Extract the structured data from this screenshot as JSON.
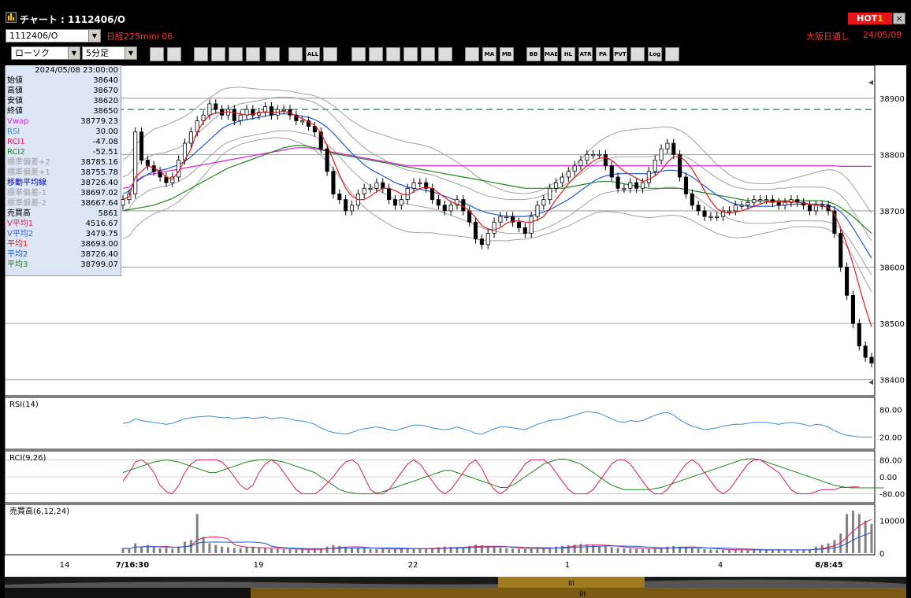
{
  "window": {
    "title": "チャート : 1112406/O",
    "hot_label": "HOT",
    "hot_num": "1",
    "close": "×"
  },
  "row1": {
    "code": "1112406/O",
    "name": "日経225mini 06",
    "session": "大阪日通し",
    "date": "24/05/09"
  },
  "controls": {
    "chart_type": "ローソク",
    "interval": "5分足"
  },
  "toolbar_icons": [
    "zoom-icon",
    "crosshair-icon",
    "download-icon",
    "magnify-icon",
    "swap-icon",
    "blank-icon",
    "candle-icon",
    "candle-icon-2",
    "all-icon",
    "pen-icon",
    "line-icon",
    "arrow-icon",
    "note-icon",
    "trash-icon",
    "settings-icon",
    "wrench-icon",
    "palette-icon",
    "ma-icon",
    "mb-icon",
    "bb-icon",
    "mae-icon",
    "hl-icon",
    "atr-icon",
    "para-icon",
    "pvt-icon",
    "box-icon",
    "log-icon",
    "exit-icon"
  ],
  "toolbar_labels": [
    "",
    "",
    "",
    "",
    "",
    "",
    "",
    "",
    "ALL",
    "",
    "",
    "",
    "",
    "",
    "",
    "",
    "",
    "MA",
    "MB",
    "BB",
    "MAE",
    "HL",
    "ATR",
    "PA RA",
    "PVT",
    "",
    "Log",
    ""
  ],
  "panel": {
    "datetime": "2024/05/08  23:00:00",
    "rows": [
      {
        "label": "始値",
        "value": "38640",
        "color": "#000000"
      },
      {
        "label": "高値",
        "value": "38670",
        "color": "#000000"
      },
      {
        "label": "安値",
        "value": "38620",
        "color": "#000000"
      },
      {
        "label": "終値",
        "value": "38650",
        "color": "#000000"
      },
      {
        "label": "Vwap",
        "value": "38779.23",
        "color": "#e01ae0"
      },
      {
        "label": "RSI",
        "value": "30.00",
        "color": "#3a8bd8"
      },
      {
        "label": "RCI1",
        "value": "-47.08",
        "color": "#e01a60"
      },
      {
        "label": "RCI2",
        "value": "-52.51",
        "color": "#1a8a1a"
      },
      {
        "label": "標準偏差+2",
        "value": "38785.16",
        "color": "#a0a0a0"
      },
      {
        "label": "標準偏差+1",
        "value": "38755.78",
        "color": "#a0a0a0"
      },
      {
        "label": "移動平均線",
        "value": "38726.40",
        "color": "#0000c0"
      },
      {
        "label": "標準偏差-1",
        "value": "38697.02",
        "color": "#a0a0a0"
      },
      {
        "label": "標準偏差-2",
        "value": "38667.64",
        "color": "#a0a0a0"
      },
      {
        "label": "売買高",
        "value": "5861",
        "color": "#000000"
      },
      {
        "label": "V平均1",
        "value": "4516.67",
        "color": "#e01a60"
      },
      {
        "label": "V平均2",
        "value": "3479.75",
        "color": "#3a5ad8"
      },
      {
        "label": "平均1",
        "value": "38693.00",
        "color": "#e01a1a"
      },
      {
        "label": "平均2",
        "value": "38726.40",
        "color": "#1a5ad8"
      },
      {
        "label": "平均3",
        "value": "38799.07",
        "color": "#1a8a1a"
      }
    ]
  },
  "colors": {
    "up": "#ffffff",
    "down": "#000000",
    "sma1": "#e01a1a",
    "sma2": "#1a5ad8",
    "sma3": "#1a8a1a",
    "vwap": "#e01ae0",
    "bb": "#a0a0a0",
    "rsi": "#3a8bd8",
    "rci1": "#e01a60",
    "rci2": "#1a8a1a",
    "vol": "#808080",
    "dashed": "#1a7a7a"
  },
  "chart_data": [
    {
      "type": "candlestick",
      "title": "",
      "y_ticks": [
        "38900",
        "38800",
        "38700",
        "38600",
        "38500",
        "38400"
      ],
      "ylim": [
        38380,
        38950
      ],
      "x_ticks": [
        "14",
        "7/16:30",
        "19",
        "22",
        "1",
        "4",
        "8/8:45"
      ],
      "dashed_level": 38880,
      "closes": [
        38720,
        38730,
        38840,
        38790,
        38780,
        38770,
        38760,
        38750,
        38760,
        38790,
        38820,
        38840,
        38860,
        38870,
        38890,
        38880,
        38870,
        38880,
        38860,
        38870,
        38880,
        38870,
        38875,
        38885,
        38870,
        38880,
        38880,
        38870,
        38860,
        38860,
        38850,
        38840,
        38810,
        38770,
        38730,
        38720,
        38700,
        38710,
        38730,
        38740,
        38740,
        38750,
        38740,
        38720,
        38710,
        38720,
        38740,
        38750,
        38750,
        38740,
        38720,
        38710,
        38700,
        38710,
        38720,
        38700,
        38680,
        38650,
        38640,
        38660,
        38680,
        38690,
        38690,
        38680,
        38670,
        38660,
        38690,
        38710,
        38720,
        38740,
        38750,
        38760,
        38770,
        38780,
        38790,
        38800,
        38800,
        38800,
        38780,
        38760,
        38740,
        38740,
        38750,
        38740,
        38750,
        38770,
        38790,
        38810,
        38820,
        38800,
        38760,
        38730,
        38710,
        38700,
        38690,
        38690,
        38690,
        38700,
        38700,
        38710,
        38710,
        38715,
        38720,
        38720,
        38720,
        38715,
        38710,
        38715,
        38720,
        38715,
        38710,
        38700,
        38710,
        38710,
        38700,
        38660,
        38600,
        38550,
        38500,
        38460,
        38440,
        38430
      ],
      "sma1": [
        38720,
        38725,
        38760,
        38770,
        38780,
        38776,
        38770,
        38760,
        38756,
        38770,
        38790,
        38810,
        38840,
        38858,
        38870,
        38874,
        38874,
        38876,
        38874,
        38872,
        38870,
        38872,
        38874,
        38876,
        38874,
        38875,
        38877,
        38874,
        38868,
        38864,
        38858,
        38852,
        38838,
        38816,
        38790,
        38764,
        38740,
        38726,
        38720,
        38720,
        38726,
        38734,
        38740,
        38740,
        38736,
        38730,
        38728,
        38734,
        38740,
        38742,
        38740,
        38732,
        38724,
        38716,
        38712,
        38708,
        38700,
        38688,
        38674,
        38668,
        38666,
        38670,
        38678,
        38682,
        38682,
        38680,
        38680,
        38684,
        38690,
        38704,
        38720,
        38734,
        38748,
        38760,
        38770,
        38780,
        38788,
        38794,
        38794,
        38790,
        38780,
        38770,
        38764,
        38758,
        38752,
        38756,
        38762,
        38772,
        38786,
        38796,
        38796,
        38788,
        38774,
        38756,
        38736,
        38718,
        38704,
        38698,
        38696,
        38698,
        38700,
        38704,
        38708,
        38712,
        38716,
        38716,
        38716,
        38716,
        38716,
        38715,
        38714,
        38712,
        38710,
        38709,
        38706,
        38694,
        38670,
        38640,
        38606,
        38566,
        38528,
        38494
      ],
      "sma2": [
        38730,
        38735,
        38750,
        38758,
        38765,
        38770,
        38772,
        38774,
        38778,
        38782,
        38788,
        38796,
        38806,
        38816,
        38826,
        38836,
        38846,
        38852,
        38856,
        38860,
        38862,
        38864,
        38866,
        38868,
        38870,
        38872,
        38872,
        38872,
        38870,
        38868,
        38866,
        38862,
        38856,
        38848,
        38838,
        38826,
        38814,
        38802,
        38792,
        38782,
        38774,
        38768,
        38762,
        38756,
        38750,
        38746,
        38742,
        38740,
        38738,
        38736,
        38734,
        38730,
        38726,
        38722,
        38718,
        38714,
        38710,
        38704,
        38700,
        38696,
        38694,
        38692,
        38690,
        38690,
        38690,
        38690,
        38692,
        38694,
        38698,
        38702,
        38708,
        38714,
        38720,
        38728,
        38736,
        38744,
        38752,
        38758,
        38762,
        38764,
        38766,
        38766,
        38766,
        38766,
        38766,
        38766,
        38768,
        38770,
        38772,
        38772,
        38770,
        38766,
        38760,
        38752,
        38744,
        38736,
        38728,
        38722,
        38716,
        38712,
        38710,
        38708,
        38708,
        38708,
        38708,
        38708,
        38710,
        38710,
        38712,
        38712,
        38712,
        38712,
        38712,
        38712,
        38710,
        38706,
        38698,
        38686,
        38670,
        38652,
        38634,
        38616
      ],
      "sma3": [
        38700,
        38702,
        38704,
        38706,
        38708,
        38710,
        38714,
        38718,
        38722,
        38728,
        38734,
        38740,
        38746,
        38752,
        38758,
        38764,
        38770,
        38776,
        38780,
        38784,
        38788,
        38792,
        38796,
        38800,
        38804,
        38808,
        38812,
        38814,
        38816,
        38816,
        38814,
        38812,
        38810,
        38806,
        38802,
        38800,
        38798,
        38796,
        38794,
        38792,
        38790,
        38788,
        38786,
        38784,
        38782,
        38780,
        38778,
        38776,
        38774,
        38772,
        38770,
        38768,
        38766,
        38764,
        38762,
        38760,
        38758,
        38756,
        38754,
        38752,
        38750,
        38748,
        38746,
        38744,
        38742,
        38740,
        38740,
        38740,
        38740,
        38740,
        38740,
        38740,
        38742,
        38744,
        38746,
        38748,
        38750,
        38752,
        38752,
        38752,
        38750,
        38748,
        38746,
        38744,
        38742,
        38740,
        38740,
        38740,
        38740,
        38740,
        38740,
        38738,
        38736,
        38734,
        38732,
        38730,
        38728,
        38726,
        38724,
        38722,
        38720,
        38718,
        38718,
        38718,
        38718,
        38718,
        38718,
        38718,
        38718,
        38718,
        38718,
        38718,
        38718,
        38718,
        38716,
        38712,
        38706,
        38698,
        38690,
        38680,
        38670,
        38660
      ],
      "vwap": [
        38740,
        38742,
        38752,
        38760,
        38764,
        38766,
        38768,
        38770,
        38772,
        38774,
        38776,
        38778,
        38780,
        38782,
        38784,
        38786,
        38788,
        38790,
        38792,
        38794,
        38796,
        38798,
        38800,
        38802,
        38804,
        38806,
        38808,
        38810,
        38812,
        38812,
        38812,
        38810,
        38808,
        38806,
        38804,
        38802,
        38800,
        38798,
        38796,
        38794,
        38792,
        38790,
        38788,
        38786,
        38784,
        38782,
        38780,
        38780,
        38780,
        38780,
        38780,
        38780,
        38780,
        38780,
        38780,
        38780,
        38780,
        38780,
        38780,
        38780,
        38780,
        38780,
        38780,
        38780,
        38780,
        38780,
        38780,
        38780,
        38780,
        38780,
        38780,
        38780,
        38780,
        38780,
        38780,
        38780,
        38780,
        38780,
        38780,
        38780,
        38780,
        38780,
        38780,
        38780,
        38780,
        38780,
        38780,
        38780,
        38780,
        38780,
        38780,
        38780,
        38780,
        38780,
        38780,
        38780,
        38780,
        38780,
        38780,
        38780,
        38780,
        38780,
        38780,
        38780,
        38780,
        38780,
        38780,
        38780,
        38780,
        38780,
        38780,
        38780,
        38780,
        38780,
        38780,
        38780,
        38779,
        38779,
        38779,
        38779,
        38779,
        38779
      ],
      "rsi": [
        50,
        52,
        60,
        56,
        54,
        52,
        50,
        48,
        50,
        55,
        60,
        62,
        64,
        65,
        66,
        64,
        62,
        63,
        60,
        62,
        63,
        61,
        62,
        64,
        60,
        62,
        62,
        60,
        56,
        55,
        52,
        48,
        40,
        34,
        30,
        28,
        26,
        30,
        35,
        38,
        40,
        42,
        40,
        36,
        34,
        38,
        42,
        46,
        46,
        44,
        40,
        38,
        36,
        38,
        42,
        38,
        34,
        28,
        26,
        32,
        38,
        42,
        42,
        40,
        38,
        36,
        42,
        48,
        52,
        56,
        58,
        60,
        64,
        68,
        72,
        76,
        74,
        72,
        66,
        60,
        54,
        52,
        56,
        54,
        56,
        62,
        68,
        72,
        74,
        68,
        58,
        50,
        44,
        40,
        36,
        38,
        40,
        44,
        46,
        48,
        48,
        50,
        52,
        52,
        52,
        50,
        48,
        50,
        52,
        50,
        48,
        44,
        48,
        46,
        42,
        34,
        28,
        24,
        22,
        20,
        20,
        20
      ],
      "rci1": [
        -20,
        20,
        70,
        80,
        60,
        20,
        -40,
        -70,
        -80,
        -40,
        20,
        60,
        80,
        80,
        80,
        80,
        70,
        40,
        0,
        -40,
        -60,
        -40,
        20,
        60,
        80,
        60,
        20,
        -20,
        -60,
        -80,
        -80,
        -80,
        -60,
        -30,
        0,
        40,
        70,
        80,
        60,
        0,
        -60,
        -80,
        -80,
        -60,
        -20,
        20,
        60,
        80,
        60,
        20,
        -20,
        -60,
        -80,
        -60,
        -20,
        20,
        60,
        80,
        40,
        -20,
        -60,
        -80,
        -60,
        -20,
        20,
        60,
        80,
        80,
        80,
        60,
        20,
        -20,
        -60,
        -80,
        -80,
        -80,
        -60,
        -20,
        20,
        60,
        80,
        80,
        60,
        20,
        -20,
        -60,
        -80,
        -80,
        -60,
        -20,
        20,
        60,
        80,
        60,
        20,
        -20,
        -60,
        -80,
        -60,
        -20,
        20,
        60,
        80,
        80,
        60,
        40,
        20,
        -20,
        -60,
        -80,
        -80,
        -80,
        -70,
        -60,
        -60,
        -60,
        -50,
        -50,
        -47,
        -47
      ],
      "rci2": [
        20,
        30,
        40,
        50,
        60,
        70,
        75,
        80,
        75,
        70,
        60,
        50,
        40,
        30,
        20,
        20,
        30,
        40,
        50,
        60,
        70,
        75,
        80,
        80,
        80,
        75,
        70,
        60,
        50,
        40,
        30,
        20,
        0,
        -20,
        -40,
        -60,
        -70,
        -75,
        -80,
        -80,
        -80,
        -75,
        -70,
        -60,
        -50,
        -40,
        -30,
        -20,
        -10,
        0,
        10,
        20,
        30,
        30,
        20,
        10,
        0,
        -10,
        -20,
        -30,
        -40,
        -50,
        -50,
        -40,
        -20,
        0,
        20,
        40,
        60,
        70,
        80,
        85,
        80,
        70,
        60,
        40,
        20,
        0,
        -20,
        -40,
        -50,
        -60,
        -60,
        -60,
        -60,
        -60,
        -55,
        -50,
        -40,
        -30,
        -20,
        -10,
        0,
        10,
        20,
        30,
        40,
        50,
        60,
        70,
        80,
        85,
        85,
        80,
        70,
        60,
        50,
        40,
        30,
        20,
        10,
        0,
        -10,
        -20,
        -30,
        -40,
        -45,
        -50,
        -52,
        -52,
        -52,
        -52,
        -52,
        -52
      ],
      "volume": [
        1500,
        1200,
        3000,
        2000,
        2500,
        1800,
        1500,
        1600,
        1400,
        2000,
        3500,
        4000,
        12000,
        5000,
        3000,
        2500,
        2000,
        1800,
        1600,
        1500,
        1800,
        2000,
        1600,
        1500,
        1400,
        1300,
        1200,
        1200,
        1100,
        1100,
        1000,
        1200,
        1500,
        2000,
        2500,
        2200,
        1800,
        1600,
        1500,
        1400,
        1300,
        1200,
        1200,
        1100,
        1300,
        1500,
        1600,
        1500,
        1400,
        1300,
        1500,
        1800,
        2000,
        1900,
        1800,
        1700,
        2200,
        2600,
        2400,
        2000,
        1800,
        1600,
        1500,
        1400,
        1300,
        1200,
        1300,
        1500,
        1600,
        1800,
        2000,
        2200,
        2400,
        2600,
        2800,
        2700,
        2400,
        2200,
        2000,
        1800,
        1600,
        1500,
        1400,
        1300,
        1200,
        1300,
        1500,
        1800,
        2000,
        2200,
        2000,
        1800,
        1600,
        1400,
        1200,
        1100,
        1000,
        1000,
        1000,
        1000,
        1000,
        1000,
        1000,
        1000,
        1000,
        1000,
        1000,
        1000,
        1000,
        1000,
        1000,
        1200,
        2000,
        2500,
        3000,
        4000,
        6000,
        12000,
        13000,
        12000,
        10000,
        9000
      ],
      "rsi_ticks": [
        "80.00",
        "20.00"
      ],
      "rci_ticks": [
        "80.00",
        "0.00",
        "-80.00"
      ],
      "vol_ticks": [
        "10000",
        "0"
      ]
    }
  ],
  "labels": {
    "rsi_title": "RSI(14)",
    "rci_title": "RCI(9,26)",
    "vol_title": "売買高(6,12,24)"
  }
}
